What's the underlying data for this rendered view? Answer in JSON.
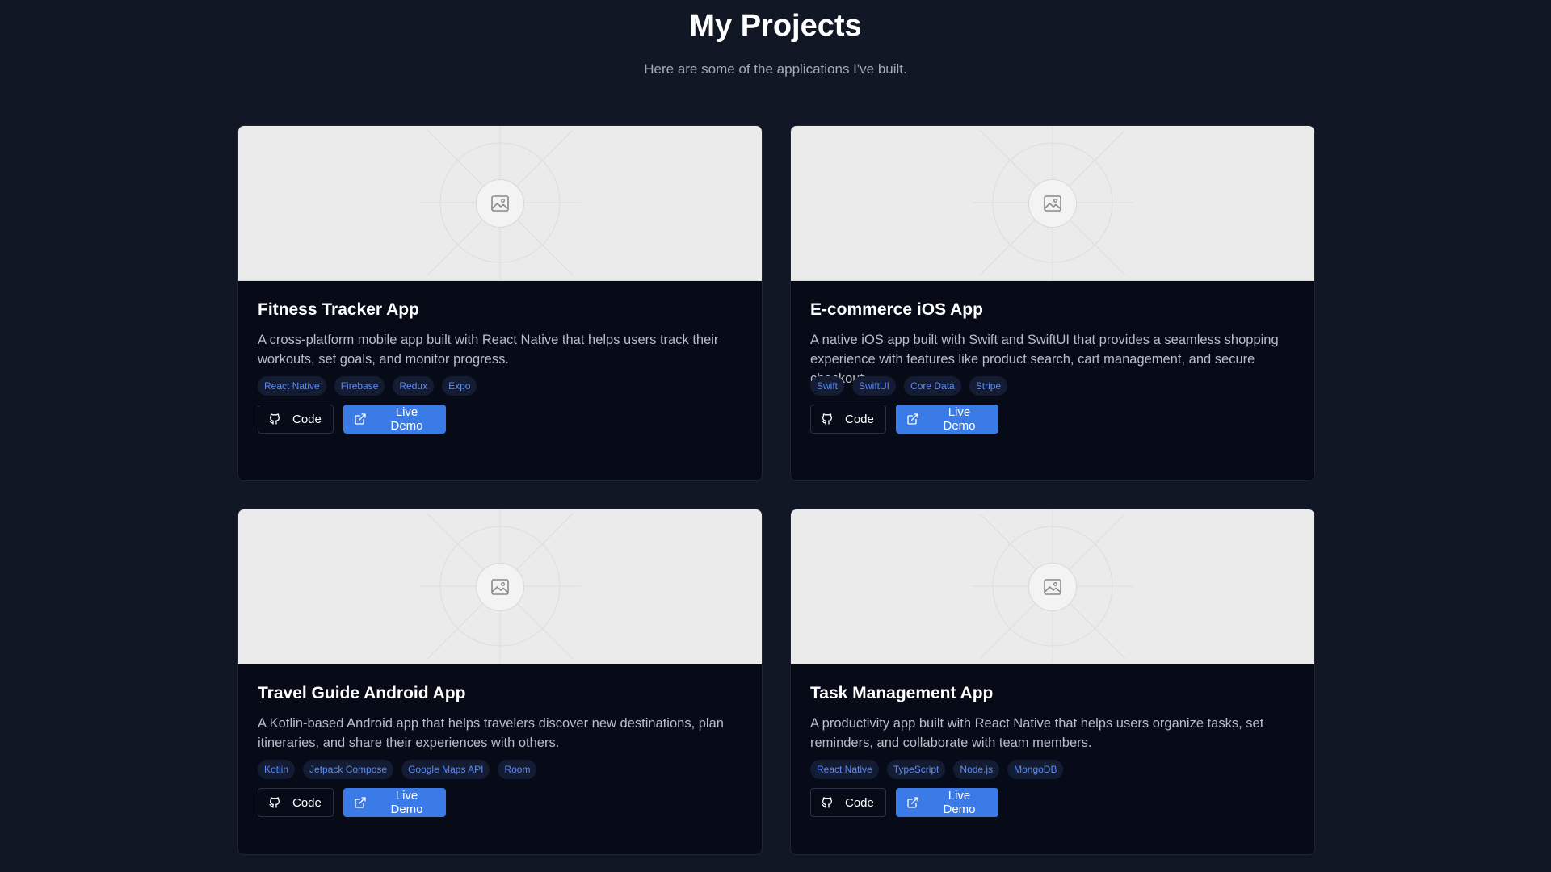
{
  "header": {
    "title": "My Projects",
    "subtitle": "Here are some of the applications I've built."
  },
  "colors": {
    "background": "#121726",
    "card": "#070b18",
    "accent": "#3b7be8",
    "tag_text": "#5d8bf4"
  },
  "projects": [
    {
      "title": "Fitness Tracker App",
      "description": "A cross-platform mobile app built with React Native that helps users track their workouts, set goals, and monitor progress.",
      "tags": [
        "React Native",
        "Firebase",
        "Redux",
        "Expo"
      ],
      "code_label": "Code",
      "demo_label": "Live Demo",
      "thumbnail_icon": "image-icon"
    },
    {
      "title": "E-commerce iOS App",
      "description": "A native iOS app built with Swift and SwiftUI that provides a seamless shopping experience with features like product search, cart management, and secure checkout.",
      "tags": [
        "Swift",
        "SwiftUI",
        "Core Data",
        "Stripe"
      ],
      "code_label": "Code",
      "demo_label": "Live Demo",
      "thumbnail_icon": "image-icon"
    },
    {
      "title": "Travel Guide Android App",
      "description": "A Kotlin-based Android app that helps travelers discover new destinations, plan itineraries, and share their experiences with others.",
      "tags": [
        "Kotlin",
        "Jetpack Compose",
        "Google Maps API",
        "Room"
      ],
      "code_label": "Code",
      "demo_label": "Live Demo",
      "thumbnail_icon": "image-icon"
    },
    {
      "title": "Task Management App",
      "description": "A productivity app built with React Native that helps users organize tasks, set reminders, and collaborate with team members.",
      "tags": [
        "React Native",
        "TypeScript",
        "Node.js",
        "MongoDB"
      ],
      "code_label": "Code",
      "demo_label": "Live Demo",
      "thumbnail_icon": "image-icon"
    }
  ]
}
